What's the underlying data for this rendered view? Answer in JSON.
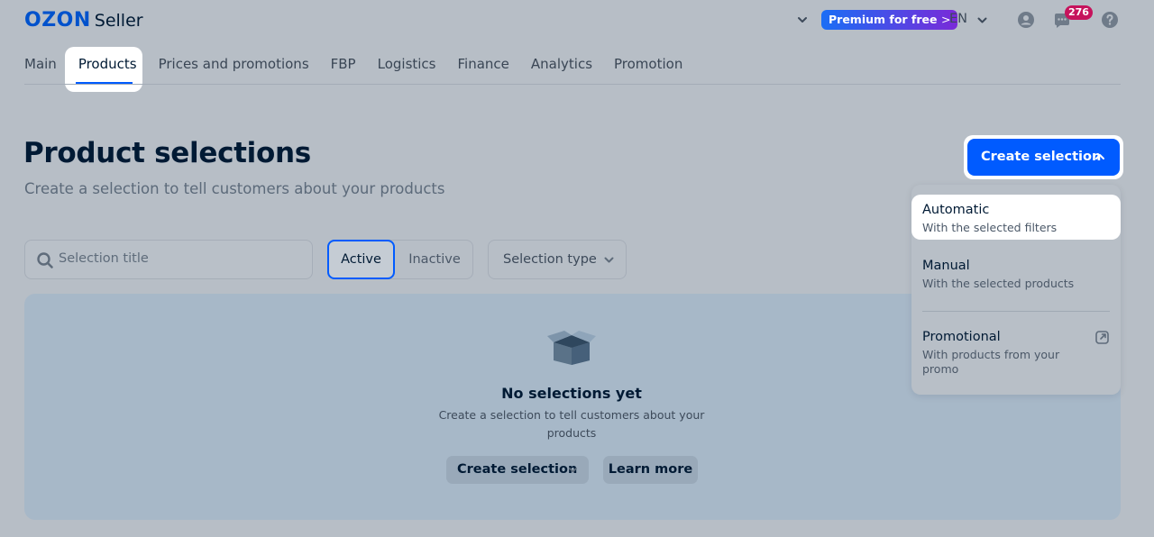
{
  "header": {
    "logo_brand": "OZON",
    "logo_product": "Seller",
    "premium_label": "Premium for free",
    "premium_arrow": ">",
    "language": "EN",
    "notifications_count": "276"
  },
  "nav": {
    "tabs": [
      {
        "label": "Main"
      },
      {
        "label": "Products"
      },
      {
        "label": "Prices and promotions"
      },
      {
        "label": "FBP"
      },
      {
        "label": "Logistics"
      },
      {
        "label": "Finance"
      },
      {
        "label": "Analytics"
      },
      {
        "label": "Promotion"
      }
    ],
    "active_tab": "Products"
  },
  "page": {
    "title": "Product selections",
    "subtitle": "Create a selection to tell customers about your products",
    "create_button_label": "Create selection"
  },
  "filters": {
    "search_placeholder": "Selection title",
    "status_active": "Active",
    "status_inactive": "Inactive",
    "selection_type_label": "Selection type"
  },
  "empty_state": {
    "title": "No selections yet",
    "description": "Create a selection to tell customers about your products",
    "create_button_label": "Create selection",
    "learn_more_label": "Learn more"
  },
  "dropdown": {
    "items": [
      {
        "title": "Automatic",
        "description": "With the selected filters"
      },
      {
        "title": "Manual",
        "description": "With the selected products"
      },
      {
        "title": "Promotional",
        "description": "With products from your promo"
      }
    ]
  },
  "icons": {
    "profile": "user-circle-icon",
    "chat": "chat-bubble-icon",
    "help": "question-circle-icon",
    "external": "external-link-icon",
    "empty": "open-box-icon"
  },
  "colors": {
    "primary": "#005bff",
    "badge": "#c6135c",
    "premium_from": "#1a6ef5",
    "premium_to": "#7a2ad8"
  }
}
